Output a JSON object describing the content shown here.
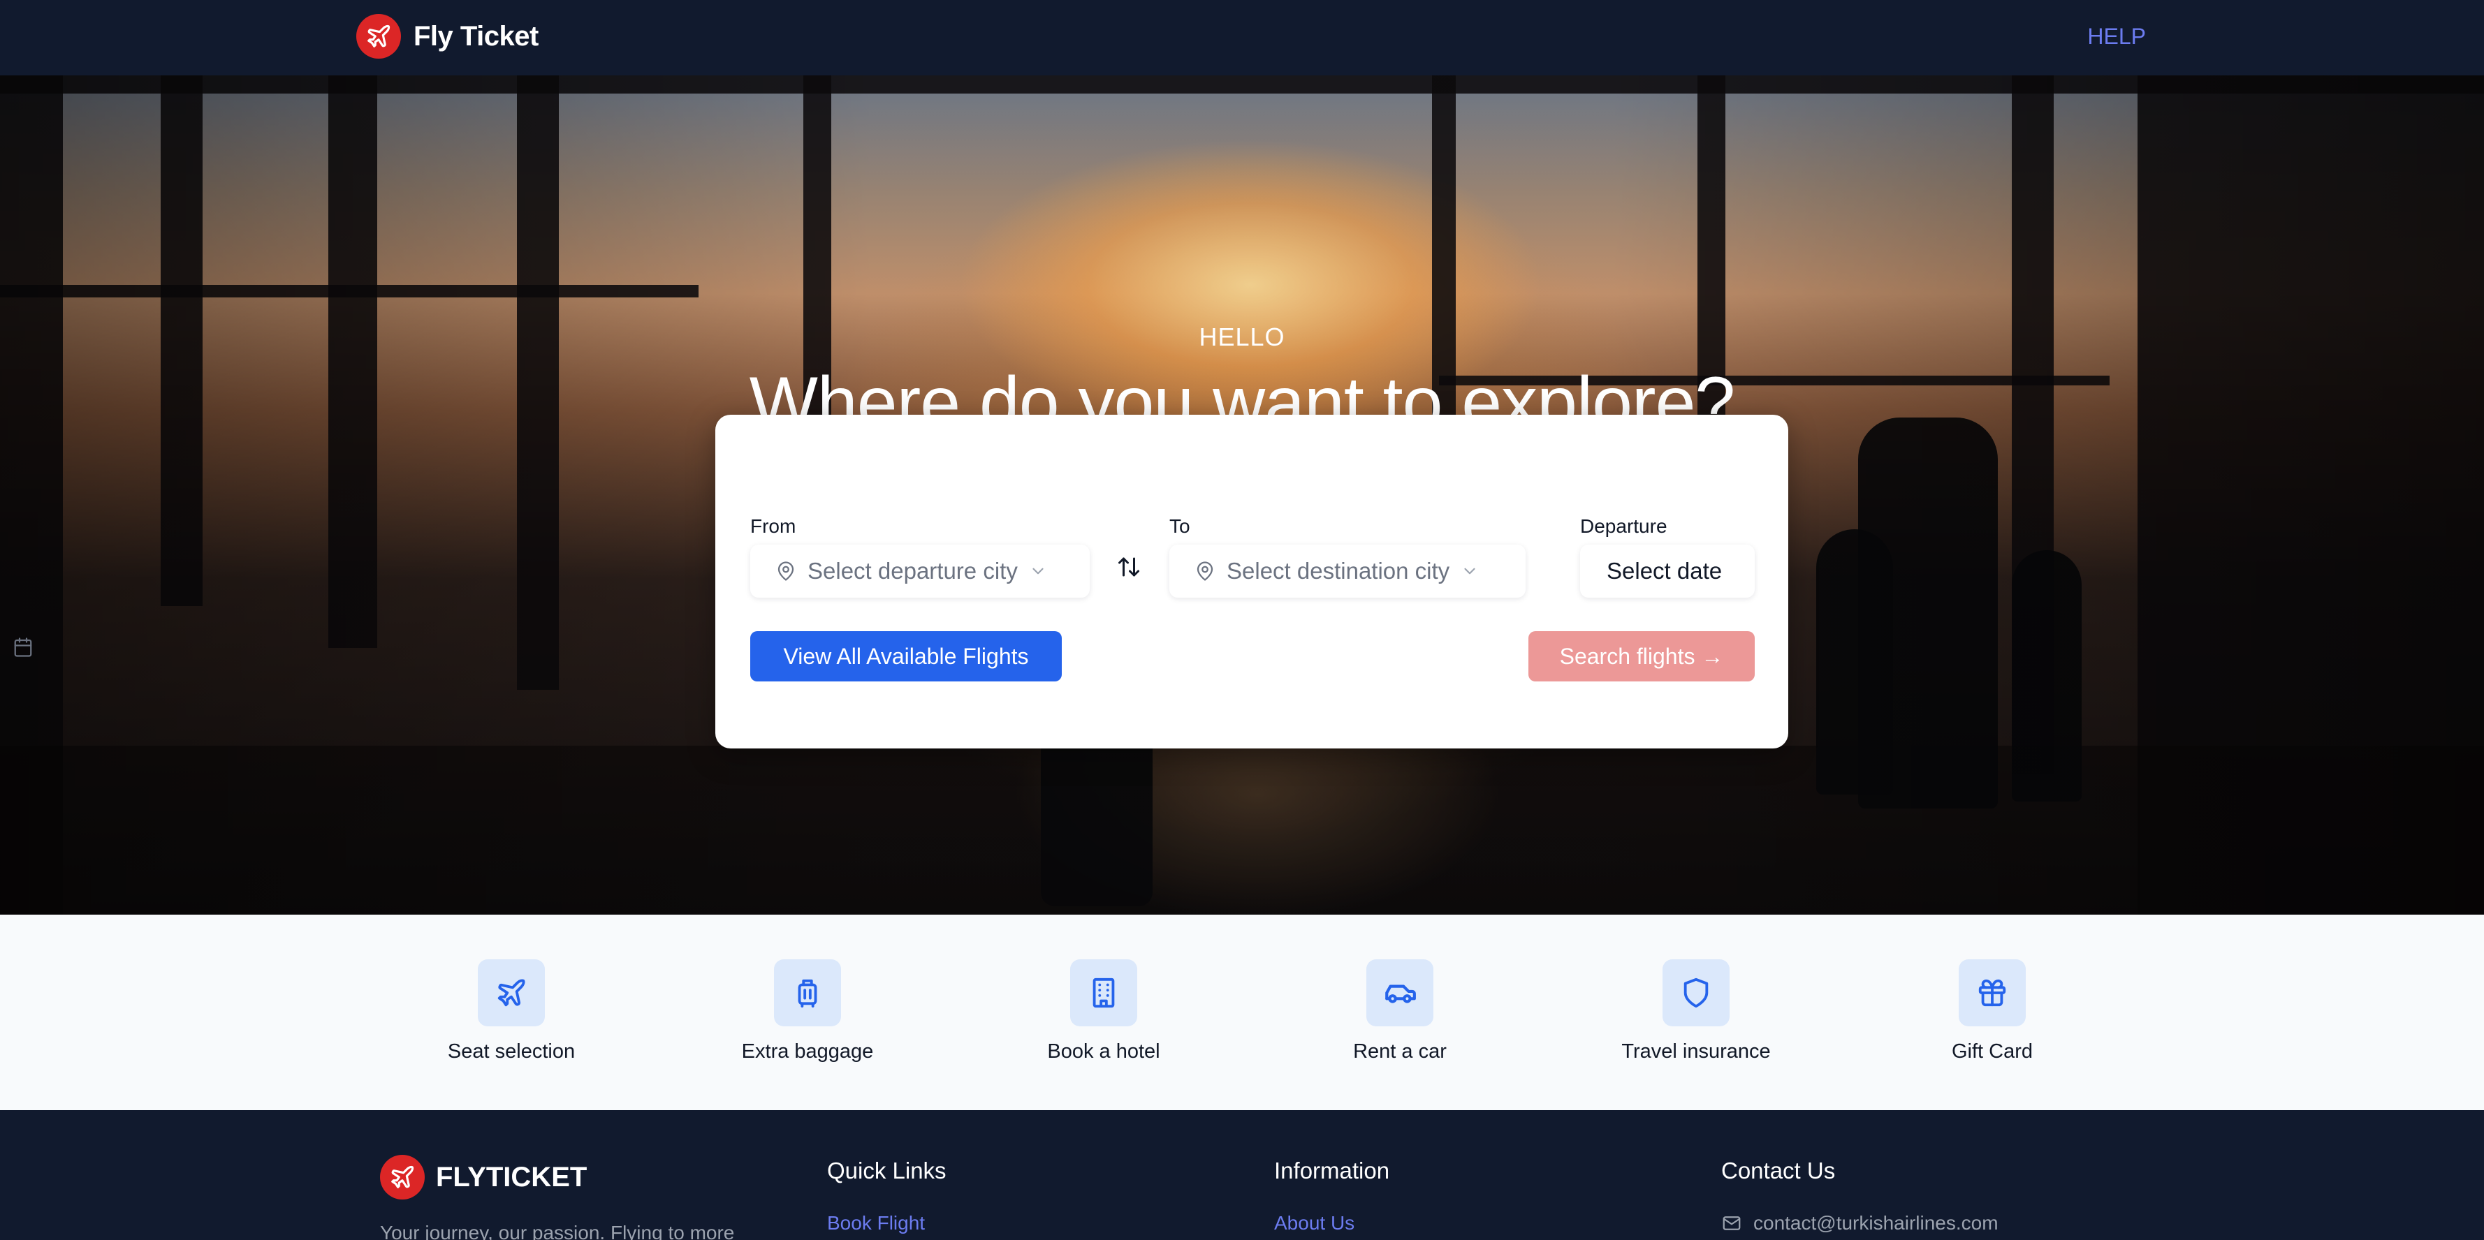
{
  "header": {
    "brand": "Fly Ticket",
    "help_label": "HELP"
  },
  "hero": {
    "greeting": "HELLO",
    "headline": "Where do you want to explore?"
  },
  "search": {
    "from_label": "From",
    "from_placeholder": "Select departure city",
    "to_label": "To",
    "to_placeholder": "Select destination city",
    "departure_label": "Departure",
    "departure_value": "Select date",
    "view_all_label": "View All Available Flights",
    "search_label": "Search flights →"
  },
  "services": [
    {
      "label": "Seat selection",
      "icon": "airplane-icon"
    },
    {
      "label": "Extra baggage",
      "icon": "luggage-icon"
    },
    {
      "label": "Book a hotel",
      "icon": "building-icon"
    },
    {
      "label": "Rent a car",
      "icon": "car-icon"
    },
    {
      "label": "Travel insurance",
      "icon": "shield-icon"
    },
    {
      "label": "Gift Card",
      "icon": "gift-icon"
    }
  ],
  "footer": {
    "brand": "FLYTICKET",
    "tagline": "Your journey, our passion. Flying to more",
    "quick_links_heading": "Quick Links",
    "quick_links": [
      "Book Flight"
    ],
    "information_heading": "Information",
    "information_links": [
      "About Us"
    ],
    "contact_heading": "Contact Us",
    "contact_email": "contact@turkishairlines.com"
  },
  "colors": {
    "accent_blue": "#2563eb",
    "brand_red": "#dc2626",
    "search_button_disabled": "#ec9897",
    "link": "#6c7cf0",
    "navy": "#111a2e"
  }
}
